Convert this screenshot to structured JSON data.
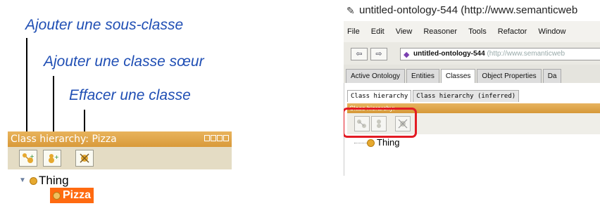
{
  "annotations": {
    "add_subclass": "Ajouter une sous-classe",
    "add_sibling": "Ajouter une classe sœur",
    "delete_class": "Effacer une classe"
  },
  "left_panel": {
    "title": "Class hierarchy: Pizza",
    "tree": {
      "root": "Thing",
      "child": "Pizza"
    }
  },
  "right_window": {
    "title": "untitled-ontology-544 (http://www.semanticweb",
    "menu": [
      "File",
      "Edit",
      "View",
      "Reasoner",
      "Tools",
      "Refactor",
      "Window"
    ],
    "address_name": "untitled-ontology-544",
    "address_url": "(http://www.semanticweb",
    "tabs": [
      "Active Ontology",
      "Entities",
      "Classes",
      "Object Properties",
      "Da"
    ],
    "active_tab": "Classes",
    "subtabs": [
      "Class hierarchy",
      "Class hierarchy (inferred)"
    ],
    "panel_title": "Class hierarchy:",
    "tree_root": "Thing"
  },
  "colors": {
    "annotation": "#1f4eb4",
    "panel_header": "#d99a3a",
    "highlight_box": "#e31b23",
    "selected": "#ff6a10"
  }
}
